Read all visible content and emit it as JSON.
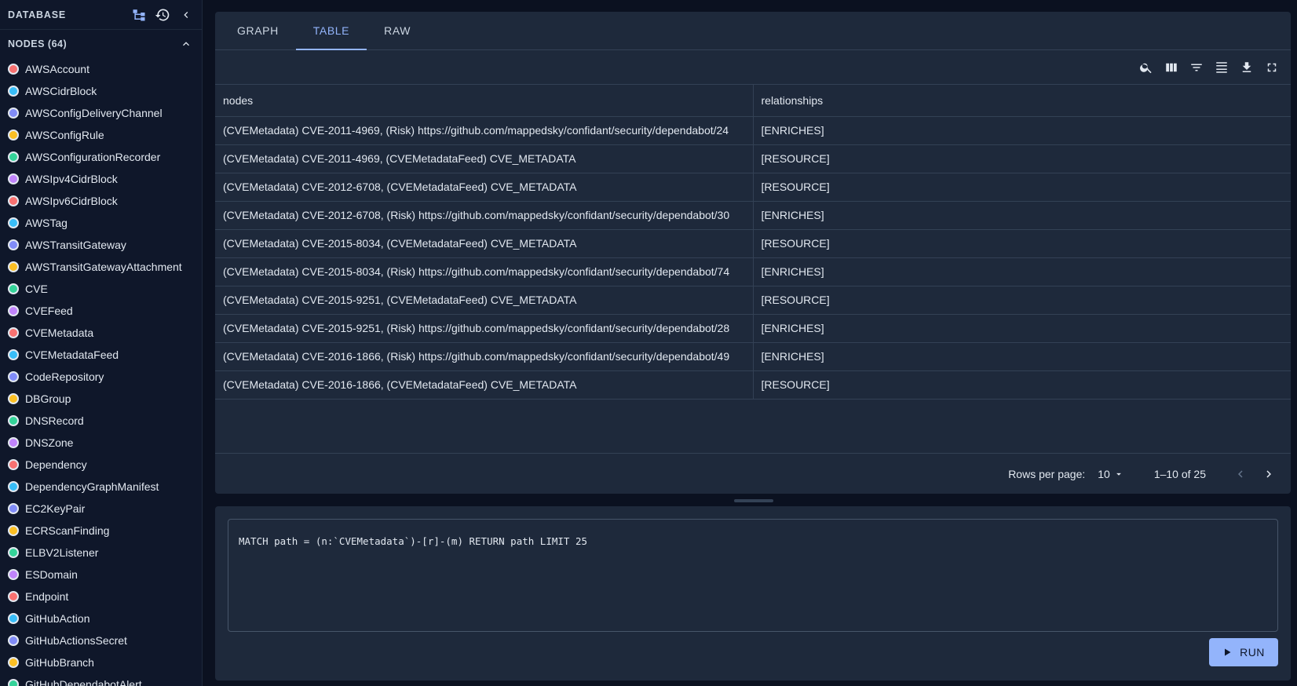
{
  "sidebar": {
    "title": "DATABASE",
    "icons": [
      "schema-icon",
      "history-icon",
      "chevron-left-icon"
    ],
    "section_title": "NODES (64)",
    "nodes": [
      {
        "label": "AWSAccount",
        "color": "#f87171"
      },
      {
        "label": "AWSCidrBlock",
        "color": "#38bdf8"
      },
      {
        "label": "AWSConfigDeliveryChannel",
        "color": "#818cf8"
      },
      {
        "label": "AWSConfigRule",
        "color": "#fbbf24"
      },
      {
        "label": "AWSConfigurationRecorder",
        "color": "#34d399"
      },
      {
        "label": "AWSIpv4CidrBlock",
        "color": "#c084fc"
      },
      {
        "label": "AWSIpv6CidrBlock",
        "color": "#f87171"
      },
      {
        "label": "AWSTag",
        "color": "#38bdf8"
      },
      {
        "label": "AWSTransitGateway",
        "color": "#818cf8"
      },
      {
        "label": "AWSTransitGatewayAttachment",
        "color": "#fbbf24"
      },
      {
        "label": "CVE",
        "color": "#34d399"
      },
      {
        "label": "CVEFeed",
        "color": "#c084fc"
      },
      {
        "label": "CVEMetadata",
        "color": "#f87171"
      },
      {
        "label": "CVEMetadataFeed",
        "color": "#38bdf8"
      },
      {
        "label": "CodeRepository",
        "color": "#818cf8"
      },
      {
        "label": "DBGroup",
        "color": "#fbbf24"
      },
      {
        "label": "DNSRecord",
        "color": "#34d399"
      },
      {
        "label": "DNSZone",
        "color": "#c084fc"
      },
      {
        "label": "Dependency",
        "color": "#f87171"
      },
      {
        "label": "DependencyGraphManifest",
        "color": "#38bdf8"
      },
      {
        "label": "EC2KeyPair",
        "color": "#818cf8"
      },
      {
        "label": "ECRScanFinding",
        "color": "#fbbf24"
      },
      {
        "label": "ELBV2Listener",
        "color": "#34d399"
      },
      {
        "label": "ESDomain",
        "color": "#c084fc"
      },
      {
        "label": "Endpoint",
        "color": "#f87171"
      },
      {
        "label": "GitHubAction",
        "color": "#38bdf8"
      },
      {
        "label": "GitHubActionsSecret",
        "color": "#818cf8"
      },
      {
        "label": "GitHubBranch",
        "color": "#fbbf24"
      },
      {
        "label": "GitHubDependabotAlert",
        "color": "#34d399"
      }
    ]
  },
  "tabs": [
    "GRAPH",
    "TABLE",
    "RAW"
  ],
  "active_tab": "TABLE",
  "toolbar_icons": [
    "search-icon",
    "columns-icon",
    "filter-icon",
    "density-icon",
    "download-icon",
    "fullscreen-icon"
  ],
  "table": {
    "headers": [
      "nodes",
      "relationships"
    ],
    "rows": [
      [
        "(CVEMetadata) CVE-2011-4969, (Risk) https://github.com/mappedsky/confidant/security/dependabot/24",
        "[ENRICHES]"
      ],
      [
        "(CVEMetadata) CVE-2011-4969, (CVEMetadataFeed) CVE_METADATA",
        "[RESOURCE]"
      ],
      [
        "(CVEMetadata) CVE-2012-6708, (CVEMetadataFeed) CVE_METADATA",
        "[RESOURCE]"
      ],
      [
        "(CVEMetadata) CVE-2012-6708, (Risk) https://github.com/mappedsky/confidant/security/dependabot/30",
        "[ENRICHES]"
      ],
      [
        "(CVEMetadata) CVE-2015-8034, (CVEMetadataFeed) CVE_METADATA",
        "[RESOURCE]"
      ],
      [
        "(CVEMetadata) CVE-2015-8034, (Risk) https://github.com/mappedsky/confidant/security/dependabot/74",
        "[ENRICHES]"
      ],
      [
        "(CVEMetadata) CVE-2015-9251, (CVEMetadataFeed) CVE_METADATA",
        "[RESOURCE]"
      ],
      [
        "(CVEMetadata) CVE-2015-9251, (Risk) https://github.com/mappedsky/confidant/security/dependabot/28",
        "[ENRICHES]"
      ],
      [
        "(CVEMetadata) CVE-2016-1866, (Risk) https://github.com/mappedsky/confidant/security/dependabot/49",
        "[ENRICHES]"
      ],
      [
        "(CVEMetadata) CVE-2016-1866, (CVEMetadataFeed) CVE_METADATA",
        "[RESOURCE]"
      ]
    ]
  },
  "pagination": {
    "rows_per_page_label": "Rows per page:",
    "rows_per_page": "10",
    "range": "1–10 of 25"
  },
  "query": {
    "text": "MATCH path = (n:`CVEMetadata`)-[r]-(m) RETURN path LIMIT 25",
    "run_label": "RUN"
  },
  "colors": {
    "accent": "#93b4fb",
    "panel": "#1e293b",
    "sidebar": "#0f172a"
  }
}
